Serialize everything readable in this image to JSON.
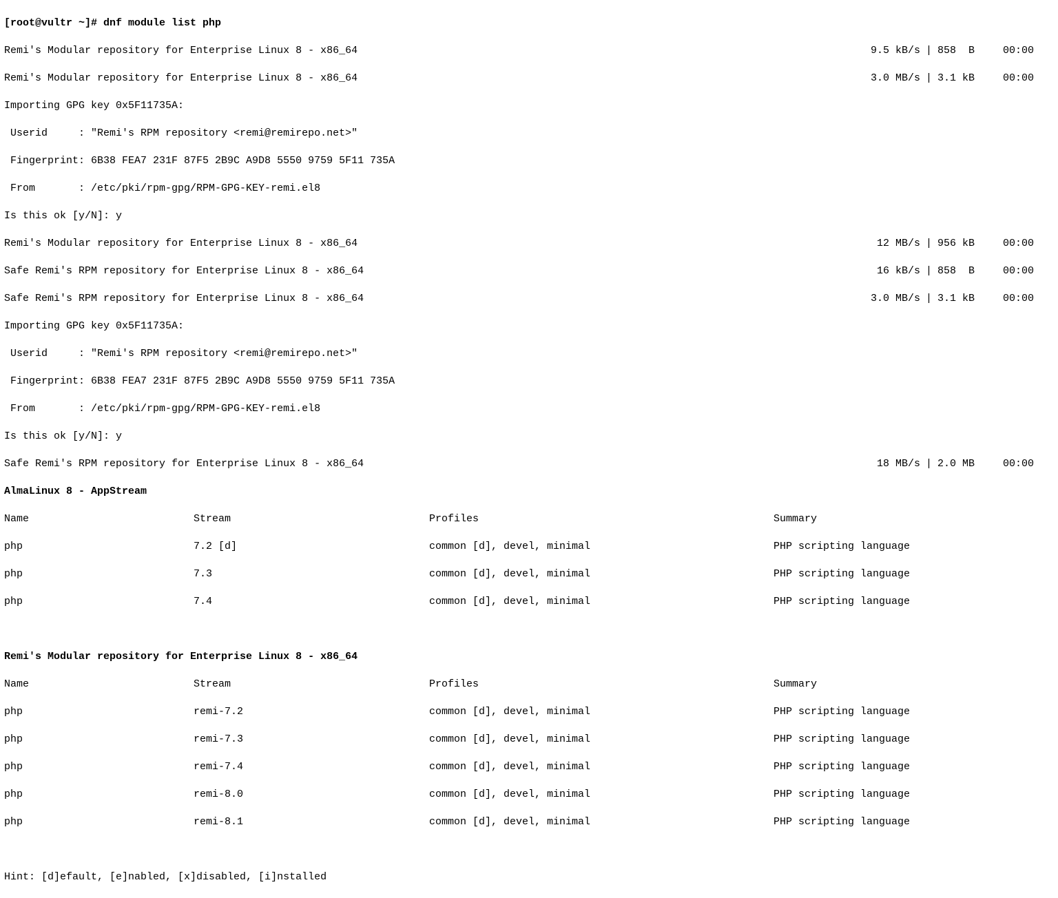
{
  "prompt": "[root@vultr ~]# dnf module list php",
  "downloads1": [
    {
      "text": "Remi's Modular repository for Enterprise Linux 8 - x86_64",
      "speed": "9.5 kB/s",
      "size": "858  B",
      "time": "00:00"
    },
    {
      "text": "Remi's Modular repository for Enterprise Linux 8 - x86_64",
      "speed": "3.0 MB/s",
      "size": "3.1 kB",
      "time": "00:00"
    }
  ],
  "gpg1": {
    "header": "Importing GPG key 0x5F11735A:",
    "userid": " Userid     : \"Remi's RPM repository <remi@remirepo.net>\"",
    "fingerprint": " Fingerprint: 6B38 FEA7 231F 87F5 2B9C A9D8 5550 9759 5F11 735A",
    "from": " From       : /etc/pki/rpm-gpg/RPM-GPG-KEY-remi.el8",
    "confirm": "Is this ok [y/N]: y"
  },
  "downloads2": [
    {
      "text": "Remi's Modular repository for Enterprise Linux 8 - x86_64",
      "speed": "12 MB/s",
      "size": "956 kB",
      "time": "00:00"
    },
    {
      "text": "Safe Remi's RPM repository for Enterprise Linux 8 - x86_64",
      "speed": "16 kB/s",
      "size": "858  B",
      "time": "00:00"
    },
    {
      "text": "Safe Remi's RPM repository for Enterprise Linux 8 - x86_64",
      "speed": "3.0 MB/s",
      "size": "3.1 kB",
      "time": "00:00"
    }
  ],
  "gpg2": {
    "header": "Importing GPG key 0x5F11735A:",
    "userid": " Userid     : \"Remi's RPM repository <remi@remirepo.net>\"",
    "fingerprint": " Fingerprint: 6B38 FEA7 231F 87F5 2B9C A9D8 5550 9759 5F11 735A",
    "from": " From       : /etc/pki/rpm-gpg/RPM-GPG-KEY-remi.el8",
    "confirm": "Is this ok [y/N]: y"
  },
  "downloads3": [
    {
      "text": "Safe Remi's RPM repository for Enterprise Linux 8 - x86_64",
      "speed": "18 MB/s",
      "size": "2.0 MB",
      "time": "00:00"
    }
  ],
  "sections": [
    {
      "title": "AlmaLinux 8 - AppStream",
      "header": {
        "name": "Name",
        "stream": "Stream",
        "profiles": "Profiles",
        "summary": "Summary"
      },
      "rows": [
        {
          "name": "php",
          "stream": "7.2 [d]",
          "profiles": "common [d], devel, minimal",
          "summary": "PHP scripting language"
        },
        {
          "name": "php",
          "stream": "7.3",
          "profiles": "common [d], devel, minimal",
          "summary": "PHP scripting language"
        },
        {
          "name": "php",
          "stream": "7.4",
          "profiles": "common [d], devel, minimal",
          "summary": "PHP scripting language"
        }
      ]
    },
    {
      "title": "Remi's Modular repository for Enterprise Linux 8 - x86_64",
      "header": {
        "name": "Name",
        "stream": "Stream",
        "profiles": "Profiles",
        "summary": "Summary"
      },
      "rows": [
        {
          "name": "php",
          "stream": "remi-7.2",
          "profiles": "common [d], devel, minimal",
          "summary": "PHP scripting language"
        },
        {
          "name": "php",
          "stream": "remi-7.3",
          "profiles": "common [d], devel, minimal",
          "summary": "PHP scripting language"
        },
        {
          "name": "php",
          "stream": "remi-7.4",
          "profiles": "common [d], devel, minimal",
          "summary": "PHP scripting language"
        },
        {
          "name": "php",
          "stream": "remi-8.0",
          "profiles": "common [d], devel, minimal",
          "summary": "PHP scripting language"
        },
        {
          "name": "php",
          "stream": "remi-8.1",
          "profiles": "common [d], devel, minimal",
          "summary": "PHP scripting language"
        }
      ]
    }
  ],
  "hint": "Hint: [d]efault, [e]nabled, [x]disabled, [i]nstalled",
  "pipe": "|"
}
